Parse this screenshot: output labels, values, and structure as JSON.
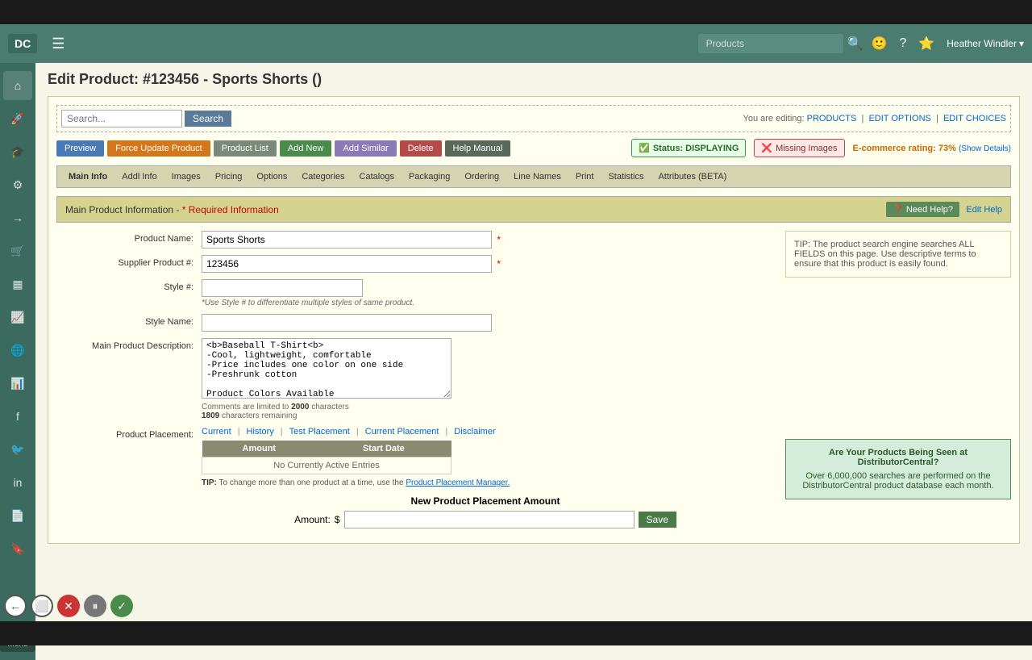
{
  "app": {
    "logo": "DC",
    "title": "Edit Product: #123456 - Sports Shorts ()"
  },
  "header": {
    "search_placeholder": "Products",
    "user": "Heather Windler"
  },
  "search_bar": {
    "placeholder": "Search...",
    "button_label": "Search",
    "editing_label": "You are editing:",
    "products_link": "PRODUCTS",
    "edit_options_link": "EDIT OPTIONS",
    "edit_choices_link": "EDIT CHOICES"
  },
  "action_buttons": [
    {
      "id": "preview",
      "label": "Preview",
      "color": "btn-blue"
    },
    {
      "id": "force-update",
      "label": "Force Update Product",
      "color": "btn-orange"
    },
    {
      "id": "product-list",
      "label": "Product List",
      "color": "btn-gray"
    },
    {
      "id": "add-new",
      "label": "Add New",
      "color": "btn-green"
    },
    {
      "id": "add-similar",
      "label": "Add Similar",
      "color": "btn-similar"
    },
    {
      "id": "delete",
      "label": "Delete",
      "color": "btn-red"
    },
    {
      "id": "help-manual",
      "label": "Help Manual",
      "color": "btn-dark"
    }
  ],
  "status": {
    "displaying_label": "Status: DISPLAYING",
    "missing_images_label": "Missing Images",
    "ecommerce_label": "E-commerce rating:",
    "ecommerce_value": "73%",
    "show_details_label": "(Show Details)"
  },
  "tabs": [
    {
      "id": "main-info",
      "label": "Main Info",
      "active": true
    },
    {
      "id": "addl-info",
      "label": "Addl Info"
    },
    {
      "id": "images",
      "label": "Images"
    },
    {
      "id": "pricing",
      "label": "Pricing"
    },
    {
      "id": "options",
      "label": "Options"
    },
    {
      "id": "categories",
      "label": "Categories"
    },
    {
      "id": "catalogs",
      "label": "Catalogs"
    },
    {
      "id": "packaging",
      "label": "Packaging"
    },
    {
      "id": "ordering",
      "label": "Ordering"
    },
    {
      "id": "line-names",
      "label": "Line Names"
    },
    {
      "id": "print",
      "label": "Print"
    },
    {
      "id": "statistics",
      "label": "Statistics"
    },
    {
      "id": "attributes",
      "label": "Attributes (BETA)"
    }
  ],
  "section": {
    "title": "Main Product Information -",
    "required_label": "* Required Information",
    "need_help_label": "❓ Need Help?",
    "edit_help_label": "Edit Help"
  },
  "tip": {
    "text": "TIP: The product search engine searches ALL FIELDS on this page. Use descriptive terms to ensure that this product is easily found."
  },
  "fields": {
    "product_name_label": "Product Name:",
    "product_name_value": "Sports Shorts",
    "supplier_product_label": "Supplier Product #:",
    "supplier_product_value": "123456",
    "style_label": "Style #:",
    "style_value": "",
    "style_note": "*Use Style # to differentiate multiple styles of same product.",
    "style_name_label": "Style Name:",
    "style_name_value": "",
    "description_label": "Main Product Description:",
    "description_value": "<b>Baseball T-Shirt<b>\n-Cool, lightweight, comfortable\n-Price includes one color on one side\n-Preshrunk cotton\n\nProduct Colors Available",
    "char_limit": "2000",
    "char_remaining": "1809",
    "char_label": "Comments are limited to",
    "char_remaining_label": "characters remaining"
  },
  "placement": {
    "label": "Product Placement:",
    "current_link": "Current",
    "history_link": "History",
    "test_placement_link": "Test Placement",
    "current_placement_link": "Current Placement",
    "disclaimer_link": "Disclaimer",
    "amount_header": "Amount",
    "start_date_header": "Start Date",
    "no_entries": "No Currently Active Entries",
    "new_placement_title": "New Product Placement Amount",
    "amount_label": "Amount:",
    "dollar_sign": "$",
    "save_label": "Save",
    "tip_label": "TIP:",
    "tip_text": "To change more than one product at a time, use the",
    "tip_link": "Product Placement Manager."
  },
  "promo": {
    "title": "Are Your Products Being Seen at DistributorCentral?",
    "text": "Over 6,000,000 searches are performed on the DistributorCentral product database each month."
  },
  "sidebar_items": [
    {
      "id": "home",
      "icon": "⌂"
    },
    {
      "id": "rocket",
      "icon": "🚀"
    },
    {
      "id": "grad",
      "icon": "🎓"
    },
    {
      "id": "gear",
      "icon": "⚙"
    },
    {
      "id": "arrow",
      "icon": "→"
    },
    {
      "id": "cart",
      "icon": "🛒"
    },
    {
      "id": "grid",
      "icon": "▦"
    },
    {
      "id": "chart",
      "icon": "📈"
    },
    {
      "id": "globe",
      "icon": "🌐"
    },
    {
      "id": "bar-chart",
      "icon": "📊"
    },
    {
      "id": "facebook",
      "icon": "f"
    },
    {
      "id": "twitter",
      "icon": "🐦"
    },
    {
      "id": "linkedin",
      "icon": "in"
    },
    {
      "id": "layer",
      "icon": "📄"
    },
    {
      "id": "bookmark",
      "icon": "🔖"
    }
  ]
}
